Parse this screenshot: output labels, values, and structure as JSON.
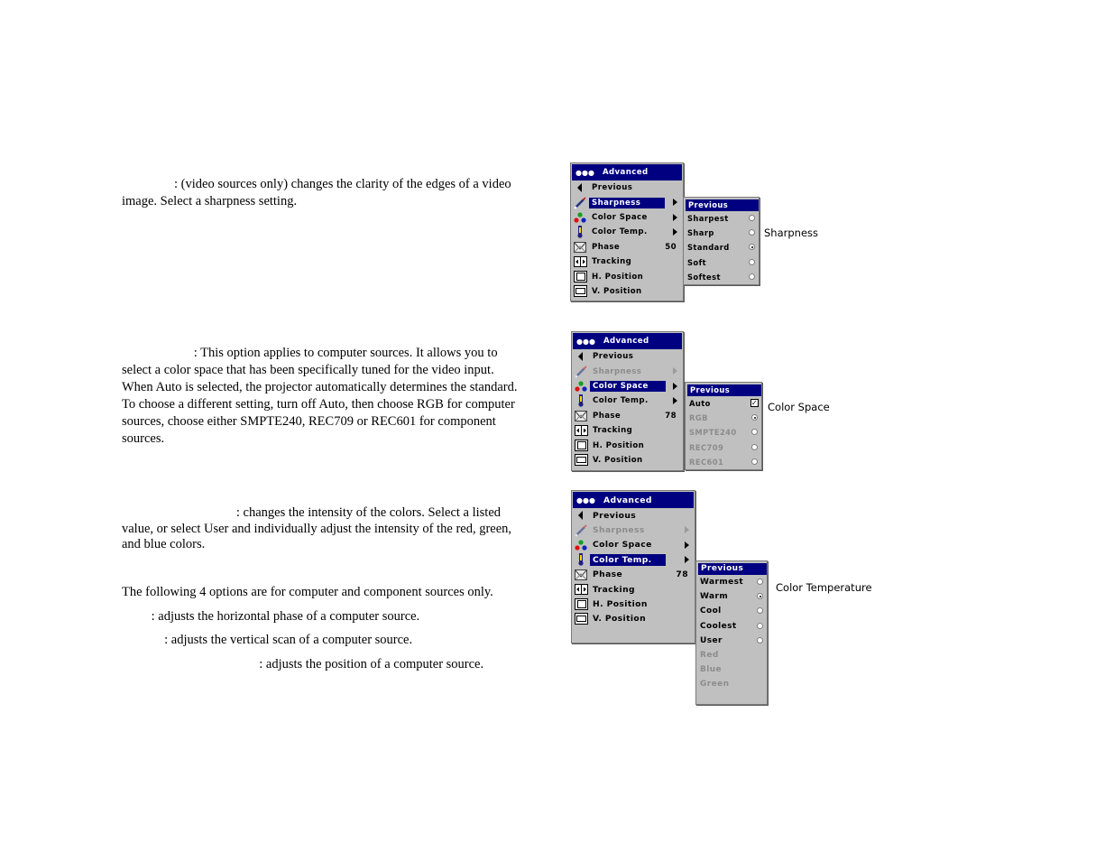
{
  "sections": {
    "sharpness": {
      "text_lines": [
        "                : (video sources only) changes the clarity of the edges of a video",
        "image. Select a sharpness setting."
      ],
      "caption": "Sharpness",
      "menu": {
        "title": "Advanced",
        "items": [
          {
            "icon": "back-arrow-icon",
            "label": "Previous"
          },
          {
            "icon": "sharpness-icon",
            "label": "Sharpness",
            "selected": true,
            "submenu": true
          },
          {
            "icon": "color-space-icon",
            "label": "Color Space",
            "submenu": true
          },
          {
            "icon": "thermometer-icon",
            "label": "Color Temp.",
            "submenu": true
          },
          {
            "icon": "phase-icon",
            "label": "Phase",
            "value": "50"
          },
          {
            "icon": "tracking-icon",
            "label": "Tracking"
          },
          {
            "icon": "h-position-icon",
            "label": "H. Position"
          },
          {
            "icon": "v-position-icon",
            "label": "V. Position"
          }
        ]
      },
      "submenu": {
        "header": "Previous",
        "options": [
          {
            "label": "Sharpest",
            "control": "radio",
            "checked": false
          },
          {
            "label": "Sharp",
            "control": "radio",
            "checked": false
          },
          {
            "label": "Standard",
            "control": "radio",
            "checked": true
          },
          {
            "label": "Soft",
            "control": "radio",
            "checked": false
          },
          {
            "label": "Softest",
            "control": "radio",
            "checked": false
          }
        ]
      }
    },
    "color_space": {
      "text_lines": [
        "                      : This option applies to computer sources. It allows you to",
        "select a color space that has been specifically tuned for the video input.",
        "When Auto is selected, the projector automatically determines the standard.",
        "To choose a different setting, turn off Auto, then choose RGB for computer",
        "sources, choose either SMPTE240, REC709 or REC601 for component",
        "sources."
      ],
      "caption": "Color Space",
      "menu": {
        "title": "Advanced",
        "items": [
          {
            "icon": "back-arrow-icon",
            "label": "Previous"
          },
          {
            "icon": "sharpness-icon",
            "label": "Sharpness",
            "disabled": true,
            "submenu": true
          },
          {
            "icon": "color-space-icon",
            "label": "Color Space",
            "selected": true,
            "submenu": true
          },
          {
            "icon": "thermometer-icon",
            "label": "Color Temp.",
            "submenu": true
          },
          {
            "icon": "phase-icon",
            "label": "Phase",
            "value": "78"
          },
          {
            "icon": "tracking-icon",
            "label": "Tracking"
          },
          {
            "icon": "h-position-icon",
            "label": "H. Position"
          },
          {
            "icon": "v-position-icon",
            "label": "V. Position"
          }
        ]
      },
      "submenu": {
        "header": "Previous",
        "options": [
          {
            "label": "Auto",
            "control": "checkbox",
            "checked": true
          },
          {
            "label": "RGB",
            "control": "radio",
            "checked": true,
            "disabled": true
          },
          {
            "label": "SMPTE240",
            "control": "radio",
            "checked": false,
            "disabled": true
          },
          {
            "label": "REC709",
            "control": "radio",
            "checked": false,
            "disabled": true
          },
          {
            "label": "REC601",
            "control": "radio",
            "checked": false,
            "disabled": true
          }
        ]
      }
    },
    "color_temp": {
      "text_lines": [
        "                                   : changes the intensity of the colors. Select a listed",
        "value, or select User and individually adjust the intensity of the red, green,",
        "and blue colors."
      ],
      "caption": "Color Temperature",
      "menu": {
        "title": "Advanced",
        "items": [
          {
            "icon": "back-arrow-icon",
            "label": "Previous"
          },
          {
            "icon": "sharpness-icon",
            "label": "Sharpness",
            "disabled": true,
            "submenu": true
          },
          {
            "icon": "color-space-icon",
            "label": "Color Space",
            "submenu": true
          },
          {
            "icon": "thermometer-icon",
            "label": "Color Temp.",
            "selected": true,
            "submenu": true
          },
          {
            "icon": "phase-icon",
            "label": "Phase",
            "value": "78"
          },
          {
            "icon": "tracking-icon",
            "label": "Tracking"
          },
          {
            "icon": "h-position-icon",
            "label": "H. Position"
          },
          {
            "icon": "v-position-icon",
            "label": "V. Position"
          }
        ]
      },
      "submenu": {
        "header": "Previous",
        "options": [
          {
            "label": "Warmest",
            "control": "radio",
            "checked": false
          },
          {
            "label": "Warm",
            "control": "radio",
            "checked": true
          },
          {
            "label": "Cool",
            "control": "radio",
            "checked": false
          },
          {
            "label": "Coolest",
            "control": "radio",
            "checked": false
          },
          {
            "label": "User",
            "control": "radio",
            "checked": false
          },
          {
            "label": "Red",
            "control": "none",
            "disabled": true
          },
          {
            "label": "Blue",
            "control": "none",
            "disabled": true
          },
          {
            "label": "Green",
            "control": "none",
            "disabled": true
          }
        ]
      }
    }
  },
  "computer_options": {
    "intro": "The following 4 options are for computer and component sources only.",
    "phase": "         : adjusts the horizontal phase of a computer source.",
    "tracking": "             : adjusts the vertical scan of a computer source.",
    "position": "                                          : adjusts the position of a computer source."
  }
}
